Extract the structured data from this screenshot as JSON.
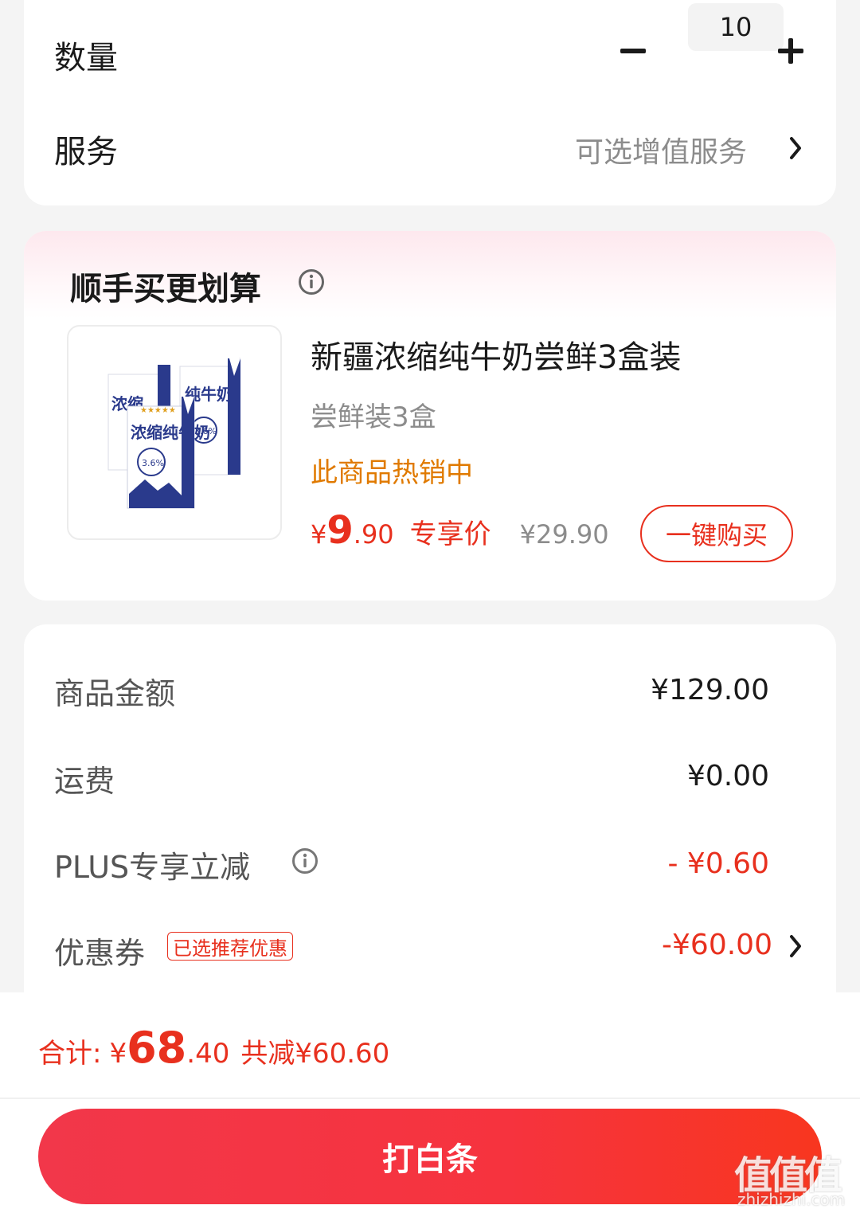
{
  "quantity": {
    "label": "数量",
    "value": "10"
  },
  "service": {
    "label": "服务",
    "hint": "可选增值服务"
  },
  "addon": {
    "title": "顺手买更划算",
    "product": {
      "name": "新疆浓缩纯牛奶尝鲜3盒装",
      "spec": "尝鲜装3盒",
      "hot_label": "此商品热销中",
      "price_currency": "¥",
      "price_int": "9",
      "price_dec": ".90",
      "price_tag": "专享价",
      "original_price": "¥29.90",
      "buy_label": "一键购买",
      "image_text": "浓缩纯牛奶"
    }
  },
  "summary": {
    "rows": [
      {
        "label": "商品金额",
        "value": "¥129.00"
      },
      {
        "label": "运费",
        "value": "¥0.00"
      },
      {
        "label": "PLUS专享立减",
        "value": "- ¥0.60"
      },
      {
        "label": "优惠券",
        "value": "-¥60.00",
        "badge": "已选推荐优惠"
      }
    ]
  },
  "footer": {
    "total_label": "合计:",
    "total_currency": "¥",
    "total_int": "68",
    "total_dec": ".40",
    "saved": "共减¥60.60",
    "pay_button": "打白条"
  },
  "watermark": {
    "main": "值值值",
    "sub": "zhizhizhi.com"
  },
  "colors": {
    "accent": "#e8301e",
    "hot": "#e07a00",
    "muted": "#8c8c8c"
  }
}
